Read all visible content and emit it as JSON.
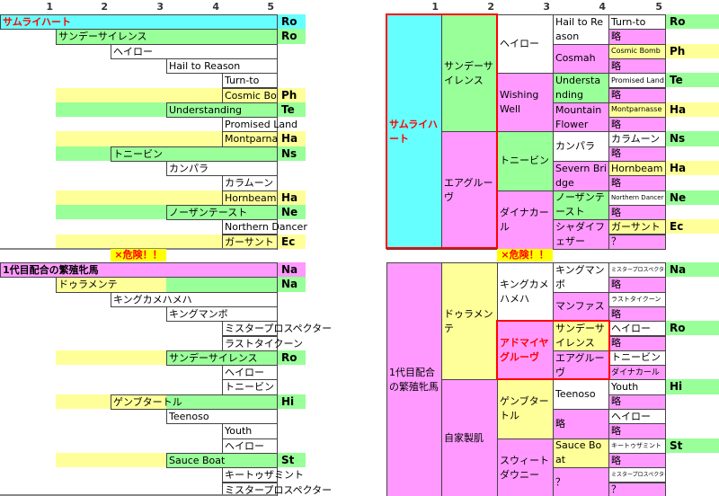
{
  "colors": {
    "cyan": "#66FFFF",
    "green": "#99FF99",
    "yellow": "#FFFF99",
    "pink": "#FF99FF",
    "white": "#FFFFFF",
    "red": "#FF0000",
    "danger_bg": "#FFFF00"
  },
  "column_headers": [
    "1",
    "2",
    "3",
    "4",
    "5"
  ],
  "danger_label": "×危険！！",
  "left_top": [
    {
      "level": 1,
      "name": "サムライハート",
      "color": "cyan",
      "code": "Ro",
      "emphasis": true
    },
    {
      "level": 2,
      "name": "サンデーサイレンス",
      "color": "green",
      "code": "Ro"
    },
    {
      "level": 3,
      "name": "ヘイロー",
      "color": "white",
      "code": ""
    },
    {
      "level": 4,
      "name": "Hail to Reason",
      "color": "white",
      "code": ""
    },
    {
      "level": 5,
      "name": "Turn-to",
      "color": "white",
      "code": ""
    },
    {
      "level": 5,
      "name": "Cosmic Bomb",
      "color": "yellow",
      "code": "Ph"
    },
    {
      "level": 4,
      "name": "Understanding",
      "color": "green",
      "code": "Te"
    },
    {
      "level": 5,
      "name": "Promised Land",
      "color": "white",
      "code": ""
    },
    {
      "level": 5,
      "name": "Montparnasse",
      "color": "yellow",
      "code": "Ha"
    },
    {
      "level": 3,
      "name": "トニービン",
      "color": "green",
      "code": "Ns"
    },
    {
      "level": 4,
      "name": "カンパラ",
      "color": "white",
      "code": ""
    },
    {
      "level": 5,
      "name": "カラムーン",
      "color": "white",
      "code": ""
    },
    {
      "level": 5,
      "name": "Hornbeam",
      "color": "yellow",
      "code": "Ha"
    },
    {
      "level": 4,
      "name": "ノーザンテースト",
      "color": "green",
      "code": "Ne"
    },
    {
      "level": 5,
      "name": "Northern Dancer",
      "color": "white",
      "code": ""
    },
    {
      "level": 5,
      "name": "ガーサント",
      "color": "yellow",
      "code": "Ec"
    }
  ],
  "left_bottom": [
    {
      "level": 1,
      "name": "1代目配合の繁殖牝馬",
      "color": "pink",
      "code": "Na",
      "bold": true
    },
    {
      "level": 2,
      "name": "ドゥラメンテ",
      "color": "yg",
      "code": "Na"
    },
    {
      "level": 3,
      "name": "キングカメハメハ",
      "color": "white",
      "code": ""
    },
    {
      "level": 4,
      "name": "キングマンボ",
      "color": "white",
      "code": ""
    },
    {
      "level": 5,
      "name": "ミスタープロスペクター",
      "color": "white",
      "code": ""
    },
    {
      "level": 5,
      "name": "ラストタイクーン",
      "color": "white",
      "code": ""
    },
    {
      "level": 4,
      "name": "サンデーサイレンス",
      "color": "yg",
      "code": "Ro"
    },
    {
      "level": 5,
      "name": "ヘイロー",
      "color": "white",
      "code": ""
    },
    {
      "level": 5,
      "name": "トニービン",
      "color": "white",
      "code": ""
    },
    {
      "level": 3,
      "name": "ゲンブタートル",
      "color": "yg",
      "code": "Hi"
    },
    {
      "level": 4,
      "name": "Teenoso",
      "color": "white",
      "code": ""
    },
    {
      "level": 5,
      "name": "Youth",
      "color": "white",
      "code": ""
    },
    {
      "level": 5,
      "name": "ヘイロー",
      "color": "white",
      "code": ""
    },
    {
      "level": 4,
      "name": "Sauce Boat",
      "color": "yg",
      "code": "St"
    },
    {
      "level": 5,
      "name": "キートゥザミント",
      "color": "white",
      "code": ""
    },
    {
      "level": 5,
      "name": "ミスタープロスペクター",
      "color": "white",
      "code": ""
    }
  ],
  "right_top": {
    "columns": [
      [
        {
          "text": "サムライハート",
          "span": 16,
          "color": "cyan",
          "emphasis": true
        }
      ],
      [
        {
          "text": "サンデーサイレンス",
          "span": 8,
          "color": "green"
        },
        {
          "text": "エアグルーヴ",
          "span": 8,
          "color": "pink"
        }
      ],
      [
        {
          "text": "ヘイロー",
          "span": 4,
          "color": "white"
        },
        {
          "text": "Wishing Well",
          "span": 4,
          "color": "pink"
        },
        {
          "text": "トニービン",
          "span": 4,
          "color": "green"
        },
        {
          "text": "ダイナカール",
          "span": 4,
          "color": "pink"
        }
      ],
      [
        {
          "text": "Hail to Reason",
          "span": 2,
          "color": "white"
        },
        {
          "text": "Cosmah",
          "span": 2,
          "color": "pink"
        },
        {
          "text": "Understanding",
          "span": 2,
          "color": "green"
        },
        {
          "text": "Mountain Flower",
          "span": 2,
          "color": "pink"
        },
        {
          "text": "カンパラ",
          "span": 2,
          "color": "white"
        },
        {
          "text": "Severn Bridge",
          "span": 2,
          "color": "pink"
        },
        {
          "text": "ノーザンテースト",
          "span": 2,
          "color": "green"
        },
        {
          "text": "シャダイフェザー",
          "span": 2,
          "color": "pink"
        }
      ],
      [
        {
          "text": "Turn-to",
          "span": 1,
          "color": "white"
        },
        {
          "text": "略",
          "span": 1,
          "color": "pink"
        },
        {
          "text": "Cosmic Bomb",
          "span": 1,
          "color": "yellow"
        },
        {
          "text": "略",
          "span": 1,
          "color": "pink"
        },
        {
          "text": "Promised Land",
          "span": 1,
          "color": "white"
        },
        {
          "text": "略",
          "span": 1,
          "color": "pink"
        },
        {
          "text": "Montparnasse",
          "span": 1,
          "color": "yellow"
        },
        {
          "text": "略",
          "span": 1,
          "color": "pink"
        },
        {
          "text": "カラムーン",
          "span": 1,
          "color": "white"
        },
        {
          "text": "略",
          "span": 1,
          "color": "pink"
        },
        {
          "text": "Hornbeam",
          "span": 1,
          "color": "yellow"
        },
        {
          "text": "略",
          "span": 1,
          "color": "pink"
        },
        {
          "text": "Northern Dancer",
          "span": 1,
          "color": "white"
        },
        {
          "text": "略",
          "span": 1,
          "color": "pink"
        },
        {
          "text": "ガーサント",
          "span": 1,
          "color": "yellow"
        },
        {
          "text": "？",
          "span": 1,
          "color": "pink"
        }
      ]
    ],
    "codes": [
      {
        "row": 1,
        "code": "Ro",
        "color": "green"
      },
      {
        "row": 3,
        "code": "Ph",
        "color": "yellow"
      },
      {
        "row": 5,
        "code": "Te",
        "color": "green"
      },
      {
        "row": 7,
        "code": "Ha",
        "color": "yellow"
      },
      {
        "row": 9,
        "code": "Ns",
        "color": "green"
      },
      {
        "row": 11,
        "code": "Ha",
        "color": "yellow"
      },
      {
        "row": 13,
        "code": "Ne",
        "color": "green"
      },
      {
        "row": 15,
        "code": "Ec",
        "color": "yellow"
      }
    ]
  },
  "right_bottom": {
    "columns": [
      [
        {
          "text": "1代目配合の繁殖牝馬",
          "span": 16,
          "color": "pink"
        }
      ],
      [
        {
          "text": "ドゥラメンテ",
          "span": 8,
          "color": "yellow"
        },
        {
          "text": "自家製肌",
          "span": 8,
          "color": "pink"
        }
      ],
      [
        {
          "text": "キングカメハメハ",
          "span": 4,
          "color": "white"
        },
        {
          "text": "アドマイヤグルーヴ",
          "span": 4,
          "color": "pink",
          "emphasis": true
        },
        {
          "text": "ゲンブタートル",
          "span": 4,
          "color": "yellow"
        },
        {
          "text": "スウィートダウニー",
          "span": 4,
          "color": "pink"
        }
      ],
      [
        {
          "text": "キングマンボ",
          "span": 2,
          "color": "white"
        },
        {
          "text": "マンファス",
          "span": 2,
          "color": "pink"
        },
        {
          "text": "サンデーサイレンス",
          "span": 2,
          "color": "yellow"
        },
        {
          "text": "エアグルーヴ",
          "span": 2,
          "color": "pink"
        },
        {
          "text": "Teenoso",
          "span": 2,
          "color": "white"
        },
        {
          "text": "略",
          "span": 2,
          "color": "pink"
        },
        {
          "text": "Sauce Boat",
          "span": 2,
          "color": "yellow"
        },
        {
          "text": "？",
          "span": 2,
          "color": "pink"
        }
      ],
      [
        {
          "text": "ミスタープロスペクター",
          "span": 1,
          "color": "white"
        },
        {
          "text": "略",
          "span": 1,
          "color": "pink"
        },
        {
          "text": "ラストタイクーン",
          "span": 1,
          "color": "white"
        },
        {
          "text": "略",
          "span": 1,
          "color": "pink"
        },
        {
          "text": "ヘイロー",
          "span": 1,
          "color": "white"
        },
        {
          "text": "略",
          "span": 1,
          "color": "pink"
        },
        {
          "text": "トニービン",
          "span": 1,
          "color": "white"
        },
        {
          "text": "ダイナカール",
          "span": 1,
          "color": "pink"
        },
        {
          "text": "Youth",
          "span": 1,
          "color": "white"
        },
        {
          "text": "略",
          "span": 1,
          "color": "pink"
        },
        {
          "text": "ヘイロー",
          "span": 1,
          "color": "white"
        },
        {
          "text": "略",
          "span": 1,
          "color": "pink"
        },
        {
          "text": "キートゥザミント",
          "span": 1,
          "color": "white"
        },
        {
          "text": "略",
          "span": 1,
          "color": "pink"
        },
        {
          "text": "ミスタープロスペクター",
          "span": 1,
          "color": "white"
        },
        {
          "text": "？",
          "span": 1,
          "color": "pink"
        }
      ]
    ],
    "codes": [
      {
        "row": 1,
        "code": "Na",
        "color": "green"
      },
      {
        "row": 5,
        "code": "Ro",
        "color": "green"
      },
      {
        "row": 9,
        "code": "Hi",
        "color": "green"
      },
      {
        "row": 13,
        "code": "St",
        "color": "green"
      }
    ]
  }
}
